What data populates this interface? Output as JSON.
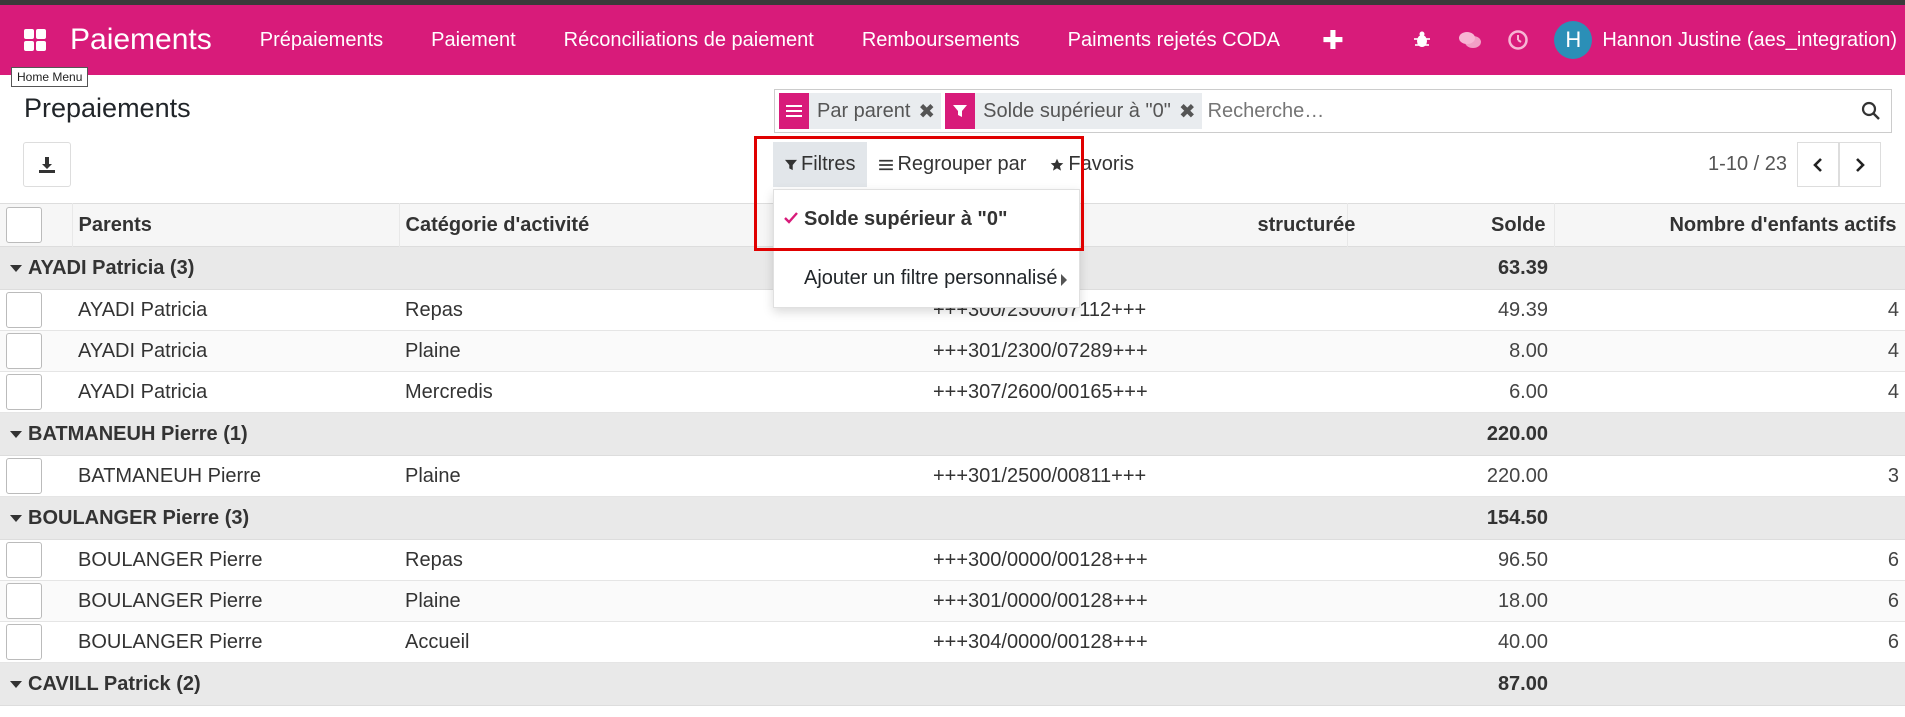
{
  "app": {
    "title": "Paiements",
    "tooltip": "Home Menu"
  },
  "nav": {
    "items": [
      "Prépaiements",
      "Paiement",
      "Réconciliations de paiement",
      "Remboursements",
      "Paiments rejetés CODA"
    ],
    "plus": "✚",
    "user_initial": "H",
    "user_name": "Hannon Justine (aes_integration)"
  },
  "page": {
    "title": "Prepaiements"
  },
  "search": {
    "facets": [
      {
        "label": "Par parent",
        "icon": "group-by-icon"
      },
      {
        "label": "Solde supérieur à \"0\"",
        "icon": "filter-icon"
      }
    ],
    "placeholder": "Recherche…"
  },
  "buttons": {
    "filters": "Filtres",
    "groupby": "Regrouper par",
    "favorites": "Favoris"
  },
  "filters_dropdown": {
    "selected": "Solde supérieur à \"0\"",
    "custom": "Ajouter un filtre personnalisé"
  },
  "pager": {
    "value": "1-10 / 23"
  },
  "table": {
    "headers": {
      "parents": "Parents",
      "category": "Catégorie d'activité",
      "comm": "structurée",
      "solde": "Solde",
      "kids": "Nombre d'enfants actifs"
    },
    "groups": [
      {
        "label": "AYADI Patricia (3)",
        "total": "63.39",
        "rows": [
          {
            "parent": "AYADI Patricia",
            "category": "Repas",
            "comm": "+++300/2300/07112+++",
            "solde": "49.39",
            "kids": "4"
          },
          {
            "parent": "AYADI Patricia",
            "category": "Plaine",
            "comm": "+++301/2300/07289+++",
            "solde": "8.00",
            "kids": "4"
          },
          {
            "parent": "AYADI Patricia",
            "category": "Mercredis",
            "comm": "+++307/2600/00165+++",
            "solde": "6.00",
            "kids": "4"
          }
        ]
      },
      {
        "label": "BATMANEUH Pierre (1)",
        "total": "220.00",
        "rows": [
          {
            "parent": "BATMANEUH Pierre",
            "category": "Plaine",
            "comm": "+++301/2500/00811+++",
            "solde": "220.00",
            "kids": "3"
          }
        ]
      },
      {
        "label": "BOULANGER Pierre (3)",
        "total": "154.50",
        "rows": [
          {
            "parent": "BOULANGER Pierre",
            "category": "Repas",
            "comm": "+++300/0000/00128+++",
            "solde": "96.50",
            "kids": "6"
          },
          {
            "parent": "BOULANGER Pierre",
            "category": "Plaine",
            "comm": "+++301/0000/00128+++",
            "solde": "18.00",
            "kids": "6"
          },
          {
            "parent": "BOULANGER Pierre",
            "category": "Accueil",
            "comm": "+++304/0000/00128+++",
            "solde": "40.00",
            "kids": "6"
          }
        ]
      },
      {
        "label": "CAVILL Patrick (2)",
        "total": "87.00",
        "rows": []
      }
    ]
  },
  "colors": {
    "brand": "#d81b7a",
    "highlight": "#e00000"
  }
}
